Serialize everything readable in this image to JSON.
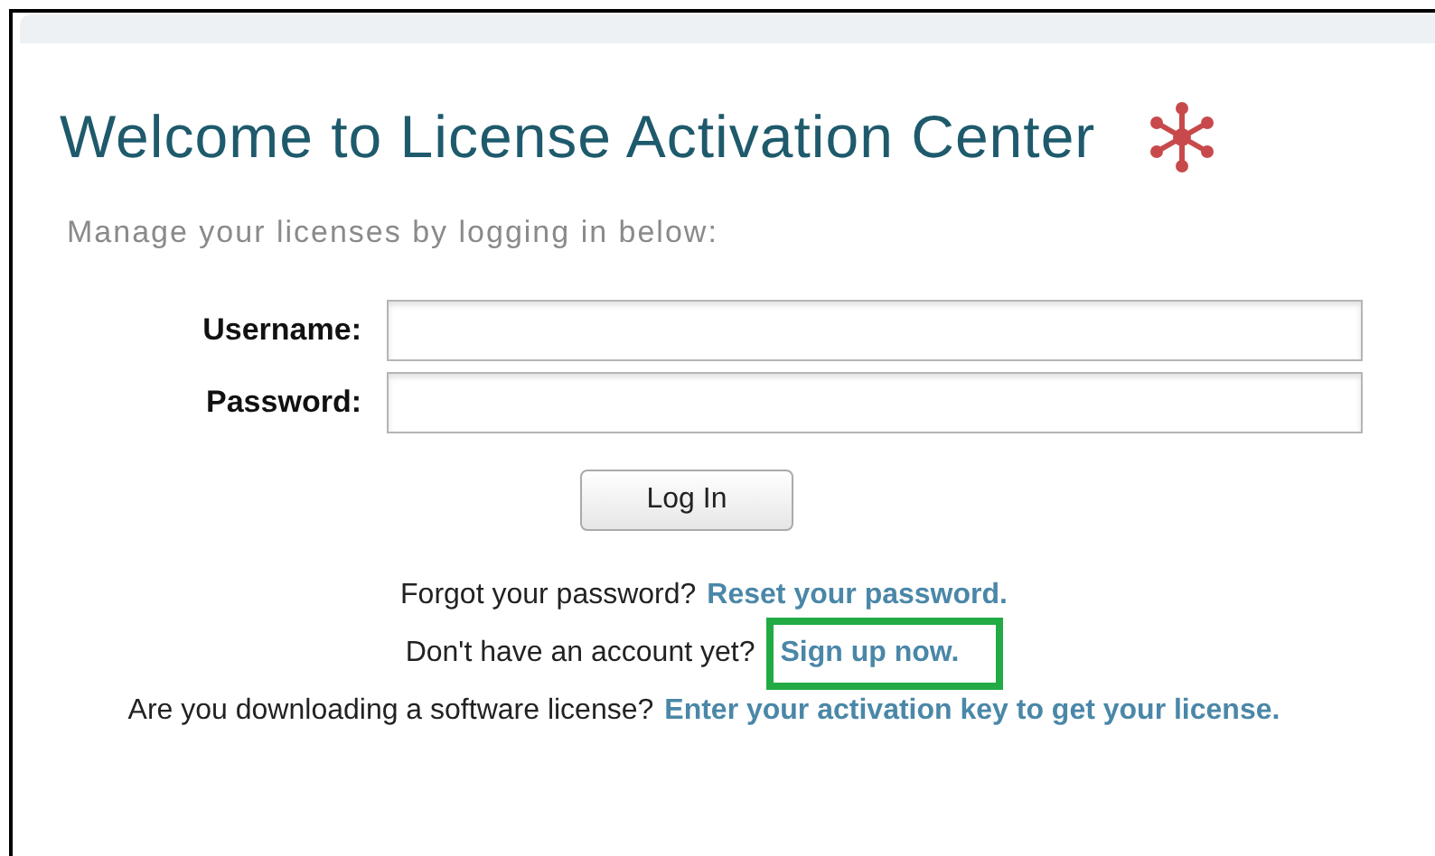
{
  "title": "Welcome to License Activation Center",
  "subtitle": "Manage your licenses by logging in below:",
  "fields": [
    {
      "label": "Username:"
    },
    {
      "label": "Password:"
    }
  ],
  "login_button": "Log In",
  "links": [
    {
      "prompt": "Forgot your password?",
      "link": "Reset your password.",
      "highlighted": false
    },
    {
      "prompt": "Don't have an account yet?",
      "link": "Sign up now.",
      "highlighted": true
    },
    {
      "prompt": "Are you downloading a software license?",
      "link": "Enter your activation key to get your license.",
      "highlighted": false
    }
  ]
}
